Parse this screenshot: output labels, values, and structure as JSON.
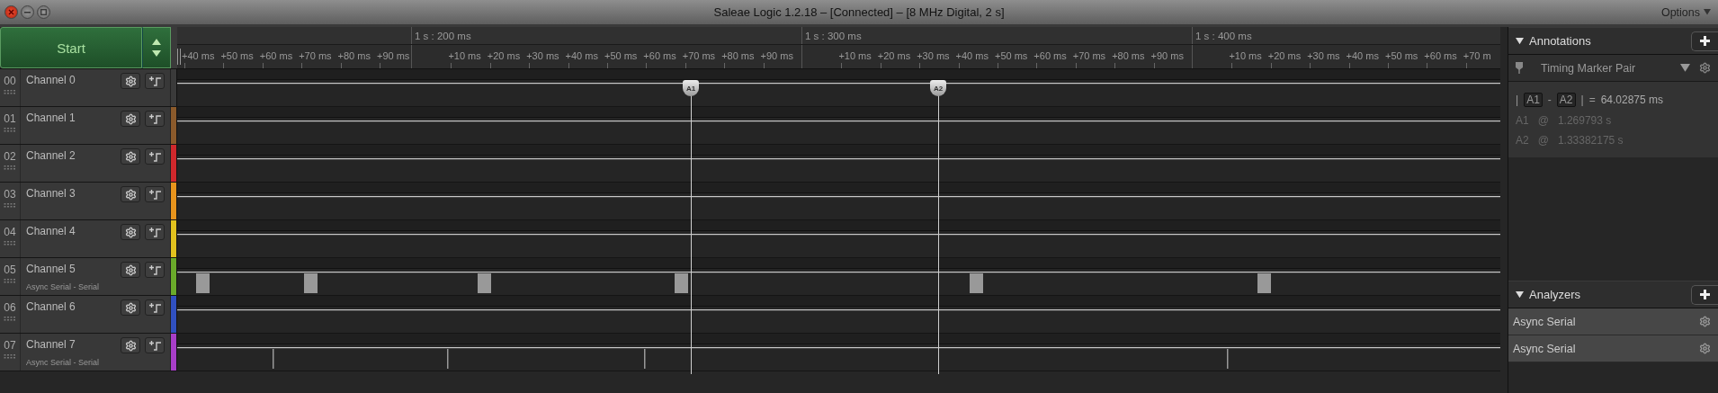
{
  "window": {
    "title": "Saleae Logic 1.2.18 – [Connected] – [8 MHz Digital, 2 s]",
    "options": "Options"
  },
  "start_button": "Start",
  "ruler": {
    "sections": [
      {
        "minor": [
          "+40 ms",
          "+50 ms",
          "+60 ms",
          "+70 ms",
          "+80 ms",
          "+90 ms"
        ]
      },
      {
        "major": "1 s : 200 ms",
        "minor": [
          "+10 ms",
          "+20 ms",
          "+30 ms",
          "+40 ms",
          "+50 ms",
          "+60 ms",
          "+70 ms",
          "+80 ms",
          "+90 ms"
        ]
      },
      {
        "major": "1 s : 300 ms",
        "minor": [
          "+10 ms",
          "+20 ms",
          "+30 ms",
          "+40 ms",
          "+50 ms",
          "+60 ms",
          "+70 ms",
          "+80 ms",
          "+90 ms"
        ]
      },
      {
        "major": "1 s : 400 ms",
        "minor": [
          "+10 ms",
          "+20 ms",
          "+30 ms",
          "+40 ms",
          "+50 ms",
          "+60 ms",
          "+70 m"
        ]
      }
    ]
  },
  "timeline_markers": [
    {
      "label": "A1"
    },
    {
      "label": "A2"
    }
  ],
  "channels": [
    {
      "number": "00",
      "name": "Channel 0",
      "color": "#3a3a3a"
    },
    {
      "number": "01",
      "name": "Channel 1",
      "color": "#8b5a2b"
    },
    {
      "number": "02",
      "name": "Channel 2",
      "color": "#d0282c"
    },
    {
      "number": "03",
      "name": "Channel 3",
      "color": "#e8941c"
    },
    {
      "number": "04",
      "name": "Channel 4",
      "color": "#e2c21e"
    },
    {
      "number": "05",
      "name": "Channel 5",
      "analyzer": "Async Serial - Serial",
      "color": "#6aaa2a"
    },
    {
      "number": "06",
      "name": "Channel 6",
      "color": "#3050c0"
    },
    {
      "number": "07",
      "name": "Channel 7",
      "analyzer": "Async Serial - Serial",
      "color": "#a83ec8"
    }
  ],
  "annotations": {
    "title": "Annotations",
    "expanded": true,
    "measurement": {
      "name": "Timing Marker Pair",
      "difference": [
        {
          "kind": "sym",
          "text": "|"
        },
        {
          "kind": "tag",
          "text": "A1"
        },
        {
          "kind": "sym",
          "text": "-"
        },
        {
          "kind": "tag",
          "text": "A2"
        },
        {
          "kind": "sym",
          "text": "|"
        },
        {
          "kind": "sym",
          "text": "="
        },
        {
          "kind": "value",
          "text": "64.02875 ms"
        }
      ],
      "markers": [
        {
          "name": "A1",
          "at": "@",
          "time": "1.269793 s"
        },
        {
          "name": "A2",
          "at": "@",
          "time": "1.33382175 s"
        }
      ]
    }
  },
  "analyzers": {
    "title": "Analyzers",
    "expanded": true,
    "items": [
      {
        "name": "Async Serial"
      },
      {
        "name": "Async Serial"
      }
    ]
  }
}
